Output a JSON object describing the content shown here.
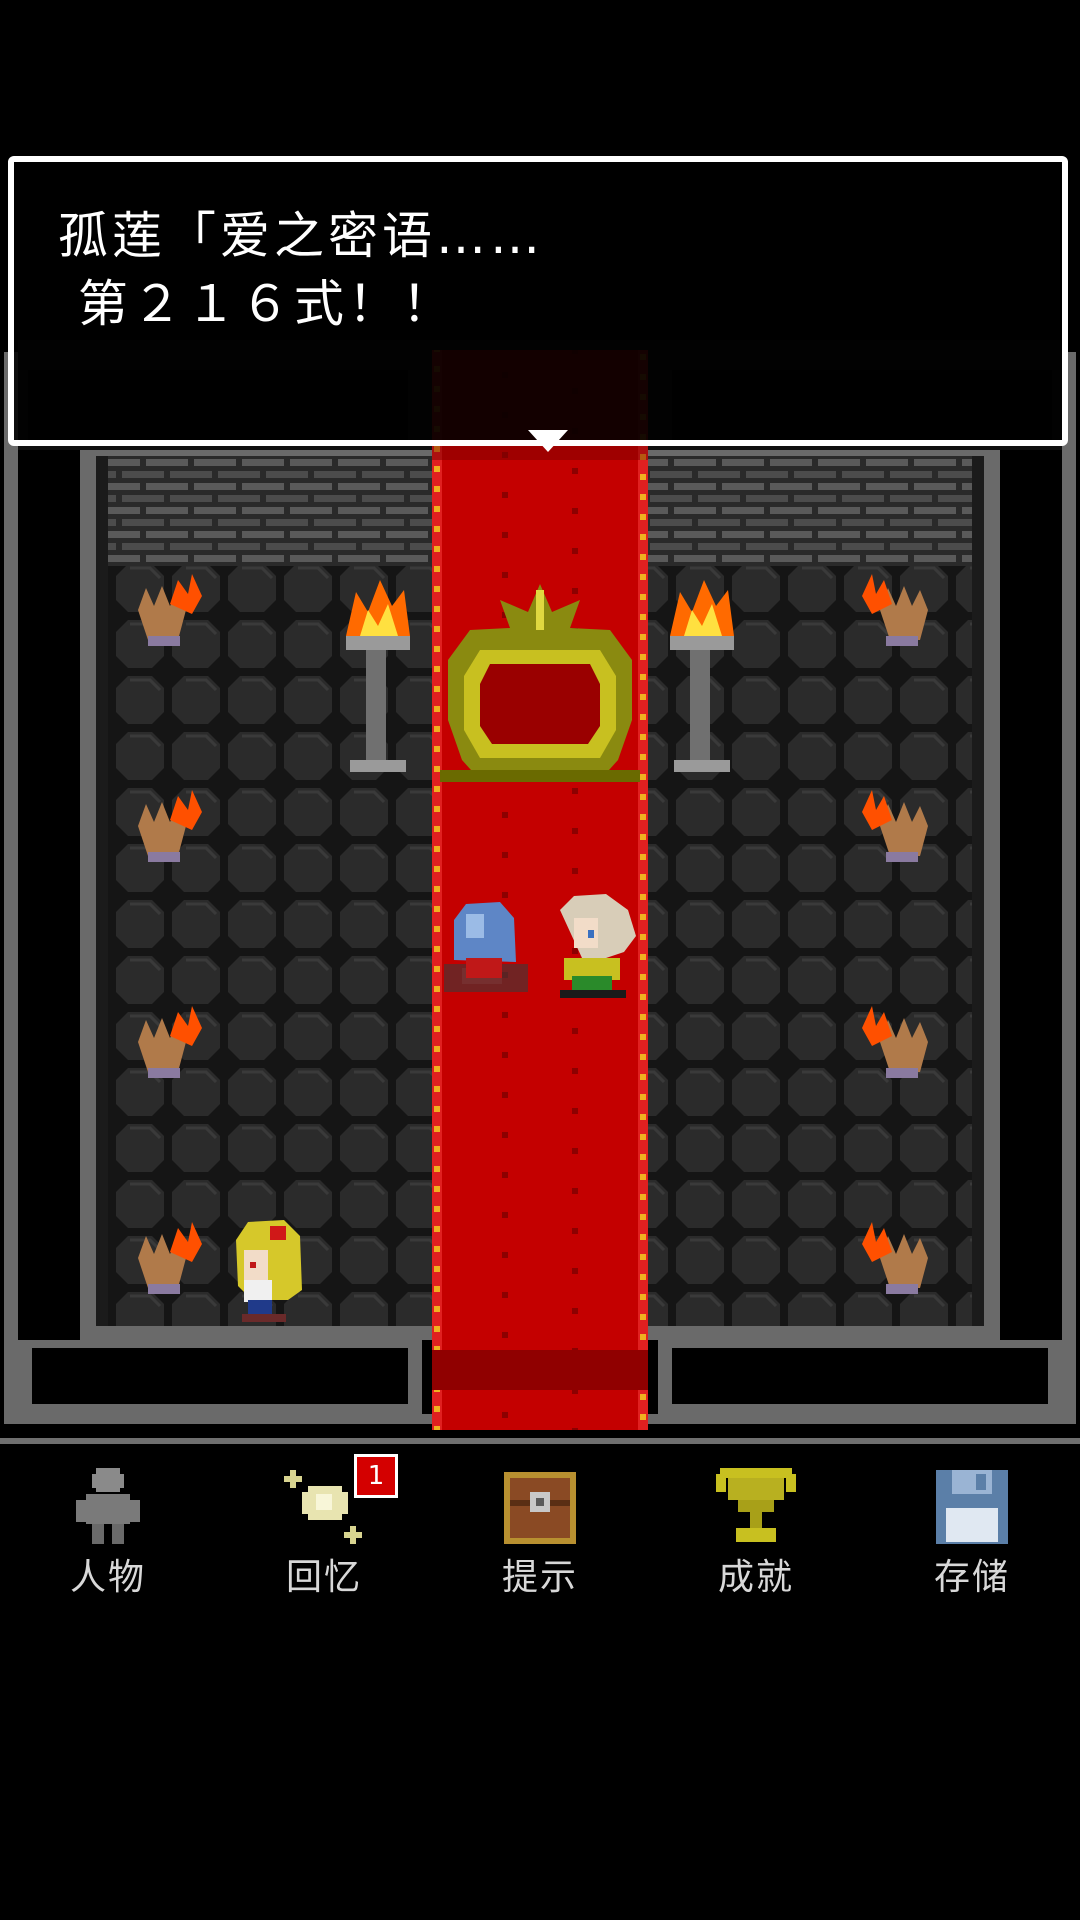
{
  "dialog": {
    "line1": "孤莲「爱之密语……",
    "line2": " 第２１６式！！"
  },
  "scene": {
    "sprites": [
      "blue-ghost-icon",
      "white-haired-character-icon",
      "blonde-girl-icon",
      "throne-icon"
    ],
    "torches": 8,
    "braziers": 2
  },
  "nav": {
    "items": [
      {
        "label": "人物",
        "icon": "person-icon"
      },
      {
        "label": "回忆",
        "icon": "memory-sparkle-icon",
        "badge": "1"
      },
      {
        "label": "提示",
        "icon": "treasure-chest-icon"
      },
      {
        "label": "成就",
        "icon": "trophy-icon"
      },
      {
        "label": "存储",
        "icon": "floppy-disk-icon"
      }
    ]
  },
  "colors": {
    "carpet": "#c00000",
    "wall": "#3a3a3a",
    "floor": "#1c1c1c",
    "badge": "#d40000",
    "trophy": "#b8b020",
    "floppy": "#5b7fa8"
  }
}
